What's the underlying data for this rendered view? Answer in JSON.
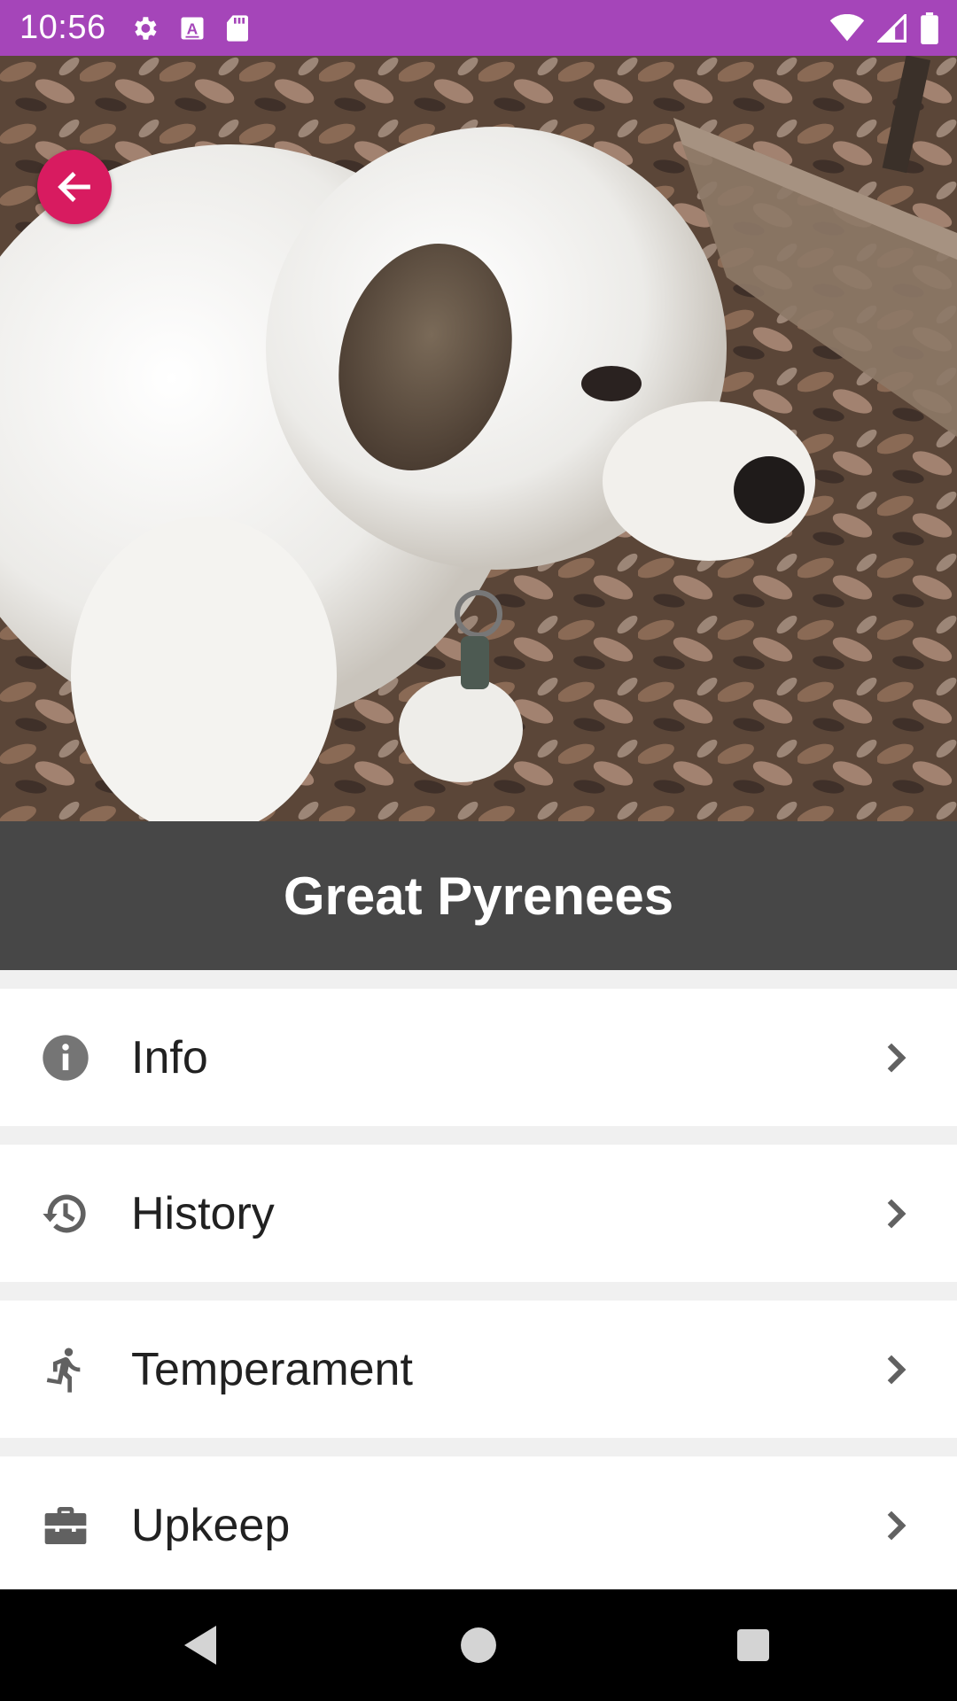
{
  "status_bar": {
    "time": "10:56",
    "left_icons": [
      "gear-icon",
      "text-a-icon",
      "sd-card-icon"
    ],
    "right_icons": [
      "wifi-icon",
      "cell-signal-icon",
      "battery-icon"
    ],
    "color": "#a545b9"
  },
  "hero": {
    "subject": "puppy-photo",
    "back_icon": "arrow-back-icon",
    "back_color": "#d81b60"
  },
  "title": "Great Pyrenees",
  "menu": [
    {
      "label": "Info",
      "icon": "info-icon"
    },
    {
      "label": "History",
      "icon": "history-icon"
    },
    {
      "label": "Temperament",
      "icon": "running-person-icon"
    },
    {
      "label": "Upkeep",
      "icon": "toolbox-icon"
    }
  ],
  "nav_bar": [
    "back-triangle-icon",
    "home-circle-icon",
    "recents-square-icon"
  ]
}
